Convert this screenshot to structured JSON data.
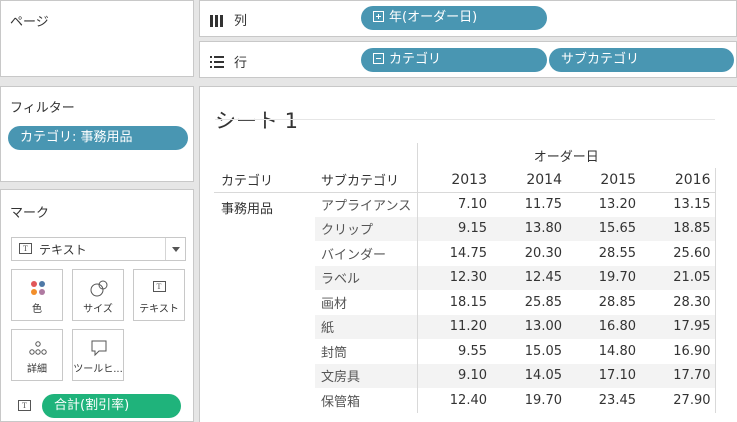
{
  "pages": {
    "title": "ページ"
  },
  "columns_shelf": {
    "label": "列",
    "pill": "年(オーダー日)"
  },
  "rows_shelf": {
    "label": "行",
    "pills": [
      "カテゴリ",
      "サブカテゴリ"
    ]
  },
  "filters": {
    "title": "フィルター",
    "pill": "カテゴリ: 事務用品"
  },
  "marks": {
    "title": "マーク",
    "mark_type": "テキスト",
    "buttons": [
      "色",
      "サイズ",
      "テキスト",
      "詳細",
      "ツールヒ..."
    ],
    "field_pill": "合計(割引率)"
  },
  "sheet": {
    "title": "シート 1"
  },
  "view_table": {
    "column_group_header": "オーダー日",
    "row_headers": [
      "カテゴリ",
      "サブカテゴリ"
    ],
    "years": [
      "2013",
      "2014",
      "2015",
      "2016"
    ],
    "category": "事務用品",
    "rows": [
      {
        "sub": "アプライアンス",
        "values": [
          "7.10",
          "11.75",
          "13.20",
          "13.15"
        ]
      },
      {
        "sub": "クリップ",
        "values": [
          "9.15",
          "13.80",
          "15.65",
          "18.85"
        ]
      },
      {
        "sub": "バインダー",
        "values": [
          "14.75",
          "20.30",
          "28.55",
          "25.60"
        ]
      },
      {
        "sub": "ラベル",
        "values": [
          "12.30",
          "12.45",
          "19.70",
          "21.05"
        ]
      },
      {
        "sub": "画材",
        "values": [
          "18.15",
          "25.85",
          "28.85",
          "28.30"
        ]
      },
      {
        "sub": "紙",
        "values": [
          "11.20",
          "13.00",
          "16.80",
          "17.95"
        ]
      },
      {
        "sub": "封筒",
        "values": [
          "9.55",
          "15.05",
          "14.80",
          "16.90"
        ]
      },
      {
        "sub": "文房具",
        "values": [
          "9.10",
          "14.05",
          "17.10",
          "17.70"
        ]
      },
      {
        "sub": "保管箱",
        "values": [
          "12.40",
          "19.70",
          "23.45",
          "27.90"
        ]
      }
    ]
  },
  "colors": {
    "pill_blue": "#4996b2",
    "pill_green": "#1fb37b",
    "band": "#f3f3f3"
  }
}
